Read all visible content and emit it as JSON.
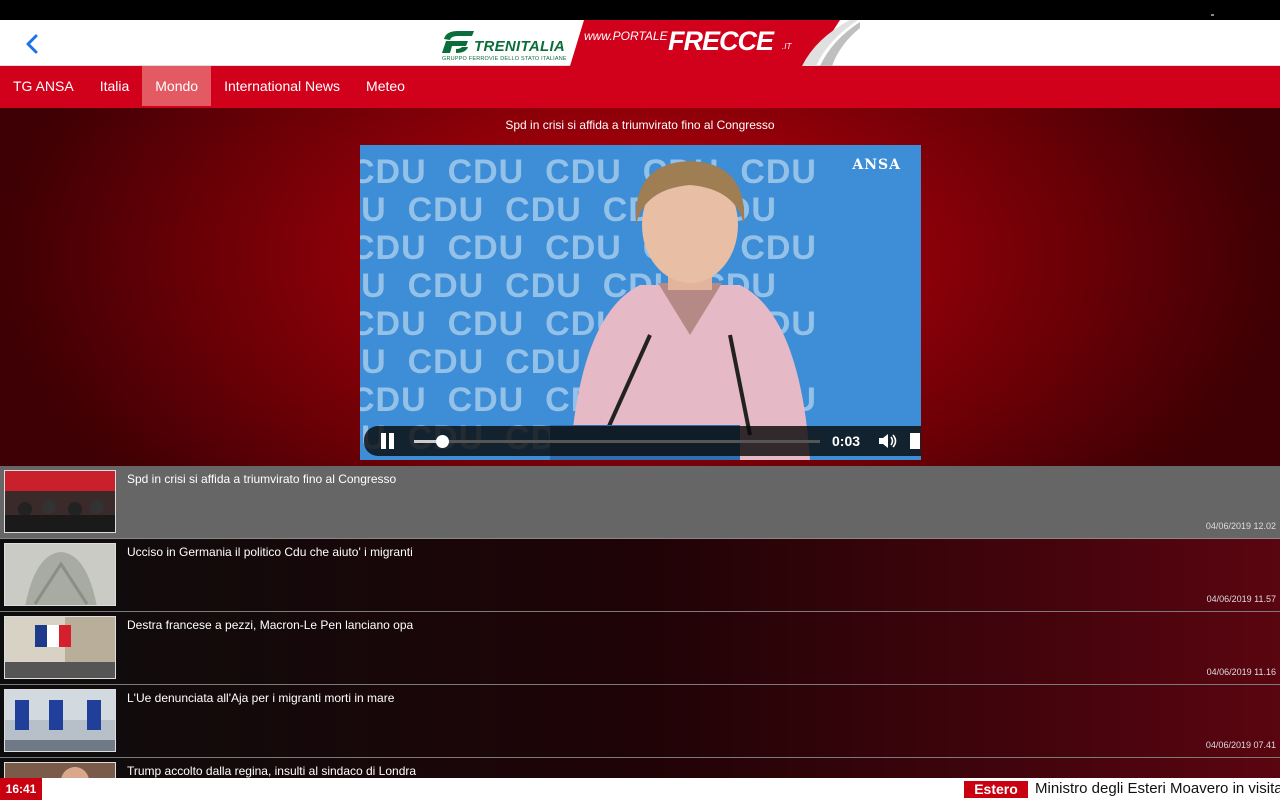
{
  "header": {
    "trenitalia_name": "TRENITALIA",
    "trenitalia_sub": "GRUPPO FERROVIE DELLO STATO ITALIANE",
    "portale_www": "www.PORTALE",
    "frecce_word": "FRECCE",
    "frecce_it": ".IT"
  },
  "nav": {
    "tabs": [
      {
        "label": "TG ANSA"
      },
      {
        "label": "Italia"
      },
      {
        "label": "Mondo",
        "active": true
      },
      {
        "label": "International News"
      },
      {
        "label": "Meteo"
      }
    ]
  },
  "video": {
    "title": "Spd in crisi si affida a triumvirato fino al Congresso",
    "watermark": "ANSA",
    "wall_text": "CDU",
    "time": "0:03",
    "progress_fraction": 0.068
  },
  "news": [
    {
      "headline": "Spd in crisi si affida a triumvirato fino al Congresso",
      "date": "04/06/2019 12.02",
      "selected": true
    },
    {
      "headline": "Ucciso in Germania il politico Cdu che aiuto' i migranti",
      "date": "04/06/2019 11.57"
    },
    {
      "headline": "Destra francese a pezzi, Macron-Le Pen lanciano opa",
      "date": "04/06/2019 11.16"
    },
    {
      "headline": "L'Ue denunciata all'Aja per i migranti morti in mare",
      "date": "04/06/2019 07.41"
    },
    {
      "headline": "Trump accolto dalla regina, insulti al sindaco di Londra",
      "date": ""
    }
  ],
  "ticker": {
    "time": "16:41",
    "category": "Estero",
    "text": "Ministro degli Esteri Moavero in visita"
  },
  "colors": {
    "brand_red": "#d1001b",
    "active_tab": "#e35a63",
    "trenitalia_green": "#0a6d3a",
    "back_blue": "#1a73e8"
  }
}
